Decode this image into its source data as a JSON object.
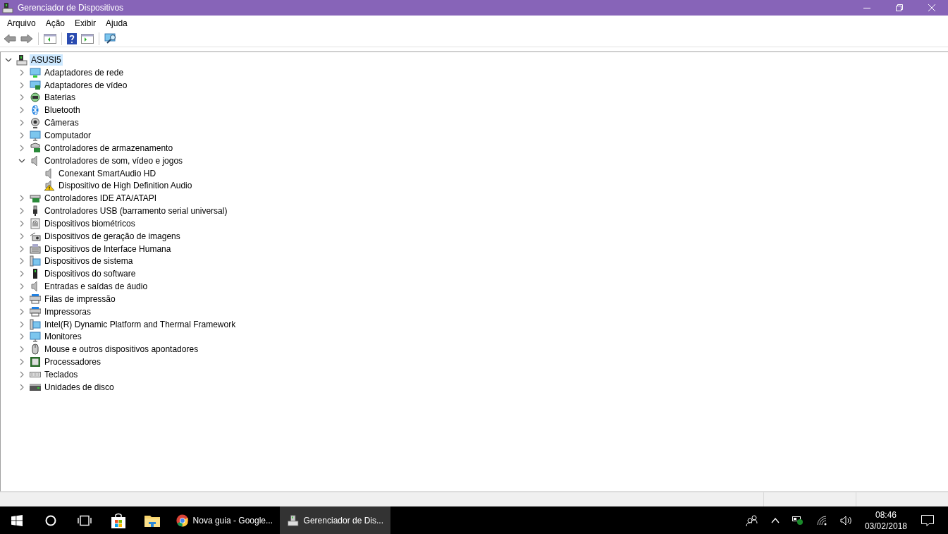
{
  "window": {
    "title": "Gerenciador de Dispositivos"
  },
  "menu": [
    "Arquivo",
    "Ação",
    "Exibir",
    "Ajuda"
  ],
  "tree": {
    "label": "ASUSI5",
    "expanded": true,
    "selected": true,
    "children": [
      {
        "label": "Adaptadores de rede",
        "expanded": false
      },
      {
        "label": "Adaptadores de vídeo",
        "expanded": false
      },
      {
        "label": "Baterias",
        "expanded": false
      },
      {
        "label": "Bluetooth",
        "expanded": false
      },
      {
        "label": "Câmeras",
        "expanded": false
      },
      {
        "label": "Computador",
        "expanded": false
      },
      {
        "label": "Controladores de armazenamento",
        "expanded": false
      },
      {
        "label": "Controladores de som, vídeo e jogos",
        "expanded": true,
        "children": [
          {
            "label": "Conexant SmartAudio HD",
            "warning": false
          },
          {
            "label": "Dispositivo de High Definition Audio",
            "warning": true
          }
        ]
      },
      {
        "label": "Controladores IDE ATA/ATAPI",
        "expanded": false
      },
      {
        "label": "Controladores USB (barramento serial universal)",
        "expanded": false
      },
      {
        "label": "Dispositivos biométricos",
        "expanded": false
      },
      {
        "label": "Dispositivos de geração de imagens",
        "expanded": false
      },
      {
        "label": "Dispositivos de Interface Humana",
        "expanded": false
      },
      {
        "label": "Dispositivos de sistema",
        "expanded": false
      },
      {
        "label": "Dispositivos do software",
        "expanded": false
      },
      {
        "label": "Entradas e saídas de áudio",
        "expanded": false
      },
      {
        "label": "Filas de impressão",
        "expanded": false
      },
      {
        "label": "Impressoras",
        "expanded": false
      },
      {
        "label": "Intel(R) Dynamic Platform and Thermal Framework",
        "expanded": false
      },
      {
        "label": "Monitores",
        "expanded": false
      },
      {
        "label": "Mouse e outros dispositivos apontadores",
        "expanded": false
      },
      {
        "label": "Processadores",
        "expanded": false
      },
      {
        "label": "Teclados",
        "expanded": false
      },
      {
        "label": "Unidades de disco",
        "expanded": false
      }
    ]
  },
  "taskbar": {
    "apps": [
      {
        "label": "Nova guia - Google...",
        "selected": false
      },
      {
        "label": "Gerenciador de Dis...",
        "selected": true
      }
    ],
    "time": "08:46",
    "date": "03/02/2018"
  }
}
